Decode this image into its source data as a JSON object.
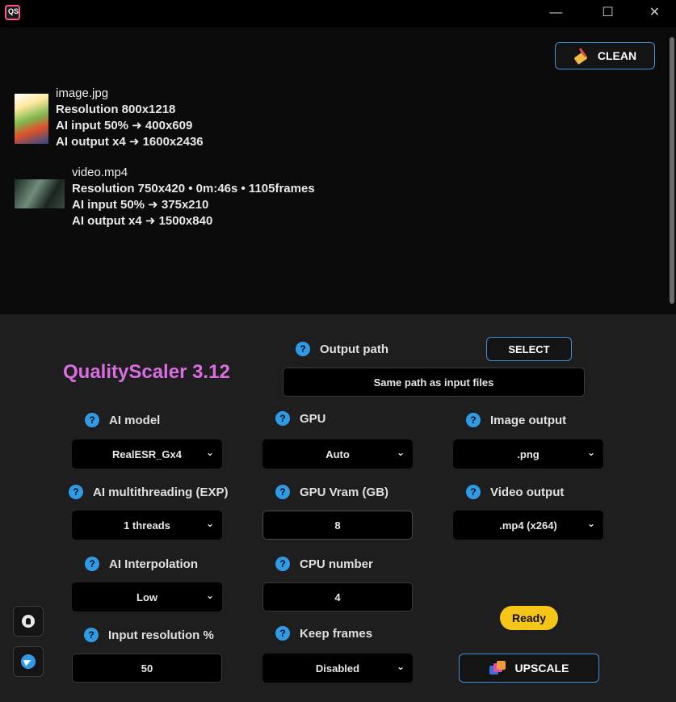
{
  "titlebar": {
    "app_icon_text": "QS",
    "minimize": "—",
    "maximize": "☐",
    "close": "✕"
  },
  "files": {
    "clean_label": "CLEAN",
    "items": [
      {
        "name": "image.jpg",
        "line1": "Resolution 800x1218",
        "line2": "AI input 50% ➜ 400x609",
        "line3": "AI output x4 ➜ 1600x2436"
      },
      {
        "name": "video.mp4",
        "line1": "Resolution 750x420 • 0m:46s • 1105frames",
        "line2": "AI input 50% ➜ 375x210",
        "line3": "AI output x4 ➜ 1500x840"
      }
    ]
  },
  "app_title": "QualityScaler 3.12",
  "output_path": {
    "label": "Output path",
    "select_label": "SELECT",
    "value": "Same path as input files"
  },
  "fields": {
    "ai_model": {
      "label": "AI model",
      "value": "RealESR_Gx4"
    },
    "gpu": {
      "label": "GPU",
      "value": "Auto"
    },
    "image_output": {
      "label": "Image output",
      "value": ".png"
    },
    "ai_multithreading": {
      "label": "AI multithreading (EXP)",
      "value": "1 threads"
    },
    "gpu_vram": {
      "label": "GPU Vram (GB)",
      "value": "8"
    },
    "video_output": {
      "label": "Video output",
      "value": ".mp4 (x264)"
    },
    "ai_interpolation": {
      "label": "AI Interpolation",
      "value": "Low"
    },
    "cpu_number": {
      "label": "CPU number",
      "value": "4"
    },
    "input_resolution": {
      "label": "Input resolution %",
      "value": "50"
    },
    "keep_frames": {
      "label": "Keep frames",
      "value": "Disabled"
    }
  },
  "help_glyph": "?",
  "chevron_glyph": "⌄",
  "status": "Ready",
  "upscale_label": "UPSCALE",
  "colors": {
    "accent_blue": "#3d8fe0",
    "title_pink": "#d96ee0",
    "status_yellow": "#f5c518",
    "help_blue": "#2f9be6"
  }
}
